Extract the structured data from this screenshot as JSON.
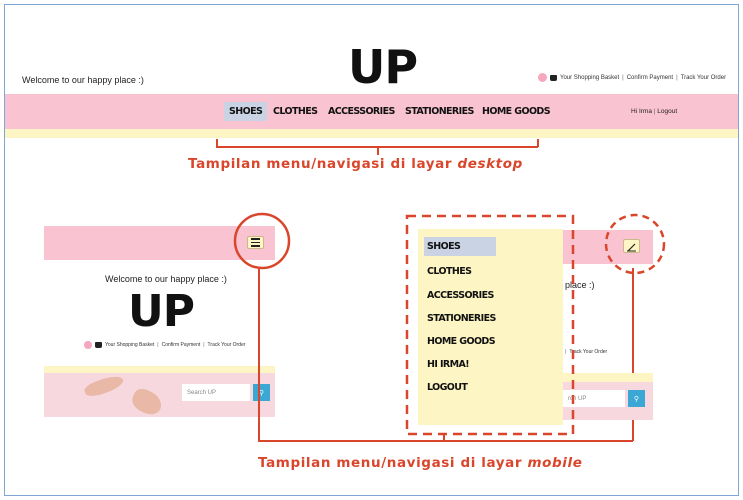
{
  "brand": {
    "logo_text": "UP"
  },
  "desktop": {
    "welcome": "Welcome to our happy place :)",
    "top_links": [
      "Your Shopping Basket",
      "Confirm Payment",
      "Track Your Order"
    ],
    "menu": [
      {
        "label": "SHOES",
        "active": true
      },
      {
        "label": "CLOTHES",
        "active": false
      },
      {
        "label": "ACCESSORIES",
        "active": false
      },
      {
        "label": "STATIONERIES",
        "active": false
      },
      {
        "label": "HOME GOODS",
        "active": false
      }
    ],
    "user_greeting": "Hi Irma",
    "logout": "Logout",
    "caption_prefix": "Tampilan menu/navigasi di layar ",
    "caption_emph": "desktop"
  },
  "mobile": {
    "welcome": "Welcome to our happy place :)",
    "welcome_partial": "place :)",
    "top_links": [
      "Your Shopping Basket",
      "Confirm Payment",
      "Track Your Order"
    ],
    "top_links_partial": "Track Your Order",
    "search_placeholder": "Search UP",
    "search_placeholder_partial": "rch UP",
    "dropdown_menu": [
      "SHOES",
      "CLOTHES",
      "ACCESSORIES",
      "STATIONERIES",
      "HOME GOODS",
      "HI IRMA!",
      "LOGOUT"
    ],
    "caption_prefix": "Tampilan menu/navigasi di layar ",
    "caption_emph": "mobile"
  },
  "colors": {
    "navbar_pink": "#f9c3d2",
    "strip_yellow": "#fdf5c4",
    "annotation_red": "#d9462b",
    "active_item": "#c9d3e3",
    "search_blue": "#3aa7d4"
  },
  "icons": [
    "hamburger-menu-icon",
    "close-pencil-icon",
    "search-icon",
    "shopping-basket-icon"
  ]
}
